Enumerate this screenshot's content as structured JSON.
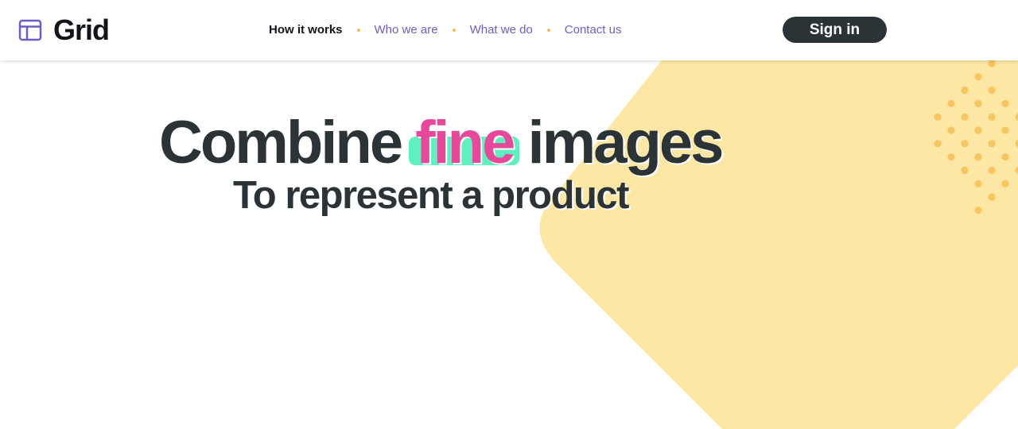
{
  "colors": {
    "accent": "#6b5fc7",
    "dark": "#2c3336",
    "highlight_text": "#e8479a",
    "highlight_bg": "#5ef0bf",
    "shape_fill": "#fde7a4",
    "dots": "#f7c660",
    "nav_dot": "#f5b950"
  },
  "header": {
    "logo_icon": "layout-icon",
    "logo_text": "Grid",
    "nav": [
      {
        "label": "How it works",
        "active": true
      },
      {
        "label": "Who we are",
        "active": false
      },
      {
        "label": "What we do",
        "active": false
      },
      {
        "label": "Contact us",
        "active": false
      }
    ],
    "signin_label": "Sign in"
  },
  "hero": {
    "title_before": "Combine",
    "title_highlight": "fine",
    "title_after": "images",
    "subtitle": "To represent a product"
  }
}
